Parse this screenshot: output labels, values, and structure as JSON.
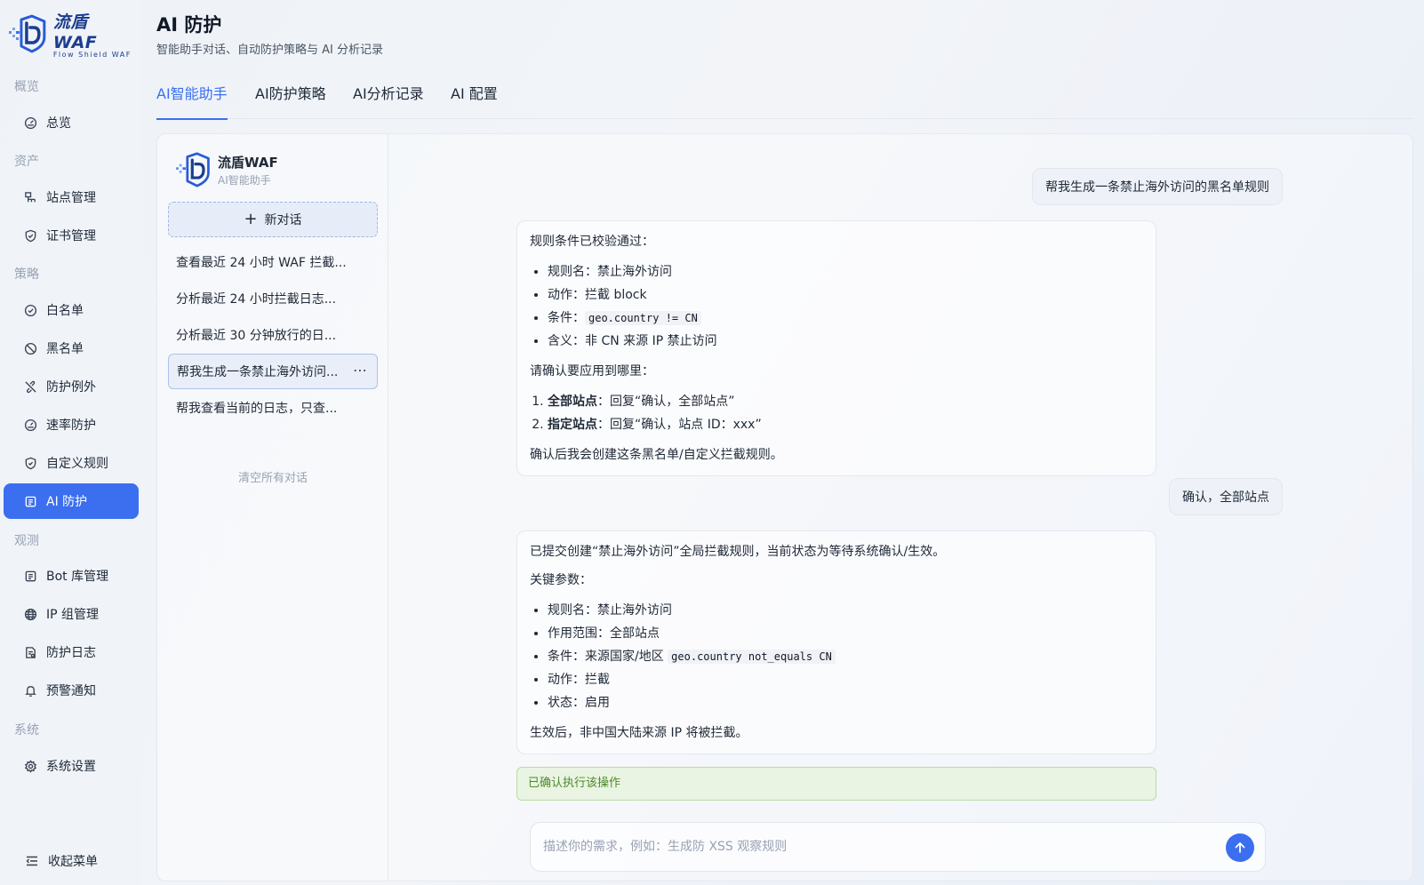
{
  "brand": {
    "logo_title": "流盾 WAF",
    "logo_sub": "Flow Shield WAF",
    "accent": "#3b6ff0"
  },
  "sidebar": {
    "groups": [
      {
        "label": "概览",
        "items": [
          {
            "label": "总览",
            "icon": "dashboard-icon"
          }
        ]
      },
      {
        "label": "资产",
        "items": [
          {
            "label": "站点管理",
            "icon": "sitemap-icon"
          },
          {
            "label": "证书管理",
            "icon": "shield-check-icon"
          }
        ]
      },
      {
        "label": "策略",
        "items": [
          {
            "label": "白名单",
            "icon": "check-circle-icon"
          },
          {
            "label": "黑名单",
            "icon": "ban-icon"
          },
          {
            "label": "防护例外",
            "icon": "link-off-icon"
          },
          {
            "label": "速率防护",
            "icon": "gauge-icon"
          },
          {
            "label": "自定义规则",
            "icon": "shield-icon"
          },
          {
            "label": "AI 防护",
            "icon": "ai-chip-icon",
            "active": true
          }
        ]
      },
      {
        "label": "观测",
        "items": [
          {
            "label": "Bot 库管理",
            "icon": "bot-icon"
          },
          {
            "label": "IP 组管理",
            "icon": "globe-icon"
          },
          {
            "label": "防护日志",
            "icon": "log-icon"
          },
          {
            "label": "预警通知",
            "icon": "bell-icon"
          }
        ]
      },
      {
        "label": "系统",
        "items": [
          {
            "label": "系统设置",
            "icon": "gear-icon"
          }
        ]
      }
    ],
    "collapse_label": "收起菜单"
  },
  "header": {
    "title": "AI 防护",
    "subtitle": "智能助手对话、自动防护策略与 AI 分析记录",
    "tabs": [
      "AI智能助手",
      "AI防护策略",
      "AI分析记录",
      "AI 配置"
    ],
    "active_tab": 0
  },
  "assistant": {
    "name": "流盾WAF",
    "sub": "AI智能助手",
    "new_chat": "新对话",
    "conversations": [
      "查看最近 24 小时 WAF 拦截...",
      "分析最近 24 小时拦截日志...",
      "分析最近 30 分钟放行的日...",
      "帮我生成一条禁止海外访问...",
      "帮我查看当前的日志，只查..."
    ],
    "selected_conversation": 3,
    "clear_all": "清空所有对话"
  },
  "chat": {
    "user_msg_1": "帮我生成一条禁止海外访问的黑名单规则",
    "ai_msg_1": {
      "intro": "规则条件已校验通过：",
      "bullets": [
        {
          "key": "规则名：",
          "val": "禁止海外访问"
        },
        {
          "key": "动作：",
          "val": "拦截 block"
        },
        {
          "key": "条件：",
          "code": "geo.country != CN"
        },
        {
          "key": "含义：",
          "val": "非 CN 来源 IP 禁止访问"
        }
      ],
      "question": "请确认要应用到哪里：",
      "options": [
        {
          "bold": "全部站点",
          "rest": "：回复“确认，全部站点”"
        },
        {
          "bold": "指定站点",
          "rest": "：回复“确认，站点 ID：xxx”"
        }
      ],
      "outro": "确认后我会创建这条黑名单/自定义拦截规则。"
    },
    "user_msg_2": "确认，全部站点",
    "ai_msg_2": {
      "intro": "已提交创建“禁止海外访问”全局拦截规则，当前状态为等待系统确认/生效。",
      "params_label": "关键参数：",
      "bullets": [
        {
          "key": "规则名：",
          "val": "禁止海外访问"
        },
        {
          "key": "作用范围：",
          "val": "全部站点"
        },
        {
          "key": "条件：",
          "val": "来源国家/地区 ",
          "code": "geo.country not_equals CN"
        },
        {
          "key": "动作：",
          "val": "拦截"
        },
        {
          "key": "状态：",
          "val": "启用"
        }
      ],
      "outro": "生效后，非中国大陆来源 IP 将被拦截。"
    },
    "confirmed_label": "已确认执行该操作",
    "input_placeholder": "描述你的需求，例如：生成防 XSS 观察规则",
    "input_value": ""
  }
}
